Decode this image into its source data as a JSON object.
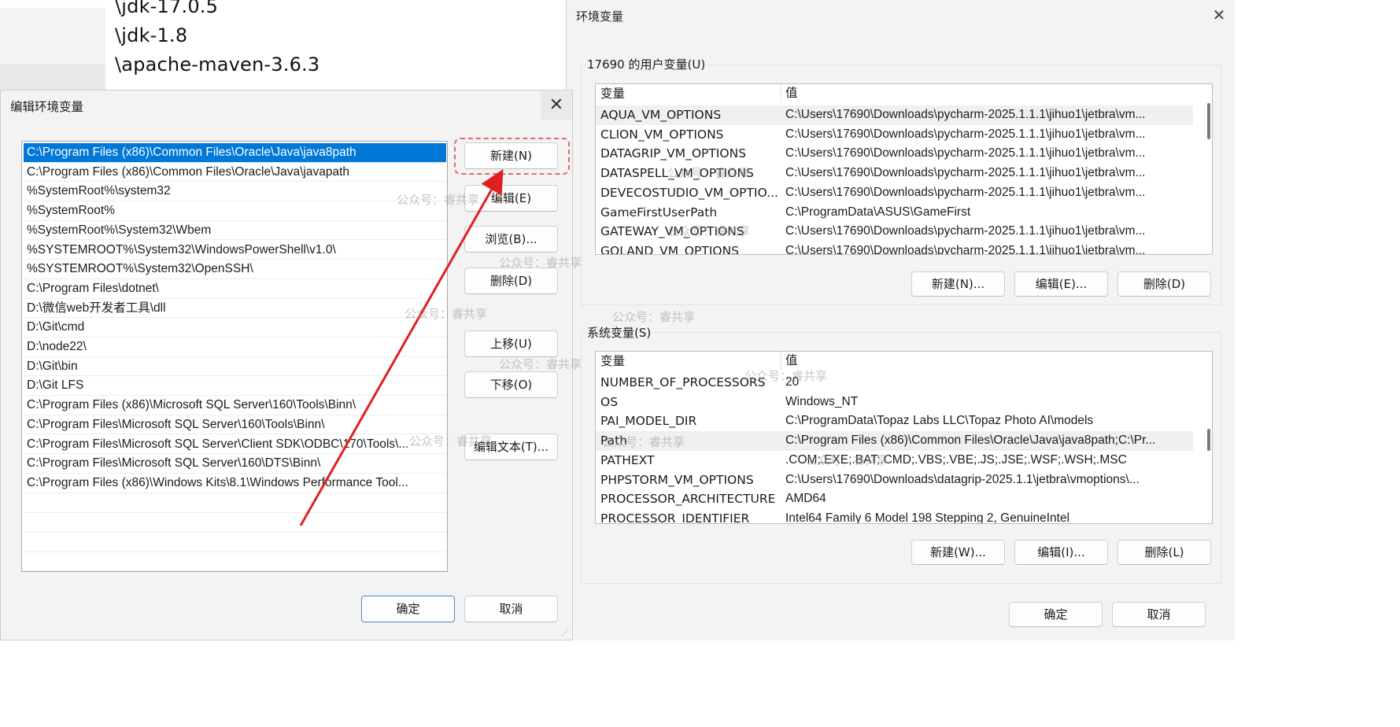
{
  "background_window": {
    "paths": [
      "\\jdk-17.0.5",
      "\\jdk-1.8",
      "\\apache-maven-3.6.3"
    ]
  },
  "env_dialog": {
    "title": "环境变量",
    "close_icon": "close-icon",
    "user_group_label": "17690 的用户变量(U)",
    "system_group_label": "系统变量(S)",
    "col_name": "变量",
    "col_value": "值",
    "user_vars": [
      {
        "name": "AQUA_VM_OPTIONS",
        "value": "C:\\Users\\17690\\Downloads\\pycharm-2025.1.1.1\\jihuo1\\jetbra\\vm..."
      },
      {
        "name": "CLION_VM_OPTIONS",
        "value": "C:\\Users\\17690\\Downloads\\pycharm-2025.1.1.1\\jihuo1\\jetbra\\vm..."
      },
      {
        "name": "DATAGRIP_VM_OPTIONS",
        "value": "C:\\Users\\17690\\Downloads\\pycharm-2025.1.1.1\\jihuo1\\jetbra\\vm..."
      },
      {
        "name": "DATASPELL_VM_OPTIONS",
        "value": "C:\\Users\\17690\\Downloads\\pycharm-2025.1.1.1\\jihuo1\\jetbra\\vm..."
      },
      {
        "name": "DEVECOSTUDIO_VM_OPTIO...",
        "value": "C:\\Users\\17690\\Downloads\\pycharm-2025.1.1.1\\jihuo1\\jetbra\\vm..."
      },
      {
        "name": "GameFirstUserPath",
        "value": "C:\\ProgramData\\ASUS\\GameFirst"
      },
      {
        "name": "GATEWAY_VM_OPTIONS",
        "value": "C:\\Users\\17690\\Downloads\\pycharm-2025.1.1.1\\jihuo1\\jetbra\\vm..."
      },
      {
        "name": "GOLAND_VM_OPTIONS",
        "value": "C:\\Users\\17690\\Downloads\\pycharm-2025.1.1.1\\jihuo1\\jetbra\\vm..."
      }
    ],
    "system_vars": [
      {
        "name": "NUMBER_OF_PROCESSORS",
        "value": "20"
      },
      {
        "name": "OS",
        "value": "Windows_NT"
      },
      {
        "name": "PAI_MODEL_DIR",
        "value": "C:\\ProgramData\\Topaz Labs LLC\\Topaz Photo AI\\models"
      },
      {
        "name": "Path",
        "value": "C:\\Program Files (x86)\\Common Files\\Oracle\\Java\\java8path;C:\\Pr..."
      },
      {
        "name": "PATHEXT",
        "value": ".COM;.EXE;.BAT;.CMD;.VBS;.VBE;.JS;.JSE;.WSF;.WSH;.MSC"
      },
      {
        "name": "PHPSTORM_VM_OPTIONS",
        "value": "C:\\Users\\17690\\Downloads\\datagrip-2025.1.1\\jetbra\\vmoptions\\..."
      },
      {
        "name": "PROCESSOR_ARCHITECTURE",
        "value": "AMD64"
      },
      {
        "name": "PROCESSOR_IDENTIFIER",
        "value": "Intel64 Family 6 Model 198 Stepping 2, GenuineIntel"
      }
    ],
    "user_buttons": {
      "new": "新建(N)...",
      "edit": "编辑(E)...",
      "delete": "删除(D)"
    },
    "system_buttons": {
      "new": "新建(W)...",
      "edit": "编辑(I)...",
      "delete": "删除(L)"
    },
    "ok": "确定",
    "cancel": "取消"
  },
  "edit_dialog": {
    "title": "编辑环境变量",
    "close_icon": "close-icon",
    "paths": [
      "C:\\Program Files (x86)\\Common Files\\Oracle\\Java\\java8path",
      "C:\\Program Files (x86)\\Common Files\\Oracle\\Java\\javapath",
      "%SystemRoot%\\system32",
      "%SystemRoot%",
      "%SystemRoot%\\System32\\Wbem",
      "%SYSTEMROOT%\\System32\\WindowsPowerShell\\v1.0\\",
      "%SYSTEMROOT%\\System32\\OpenSSH\\",
      "C:\\Program Files\\dotnet\\",
      "D:\\微信web开发者工具\\dll",
      "D:\\Git\\cmd",
      "D:\\node22\\",
      "D:\\Git\\bin",
      "D:\\Git LFS",
      "C:\\Program Files (x86)\\Microsoft SQL Server\\160\\Tools\\Binn\\",
      "C:\\Program Files\\Microsoft SQL Server\\160\\Tools\\Binn\\",
      "C:\\Program Files\\Microsoft SQL Server\\Client SDK\\ODBC\\170\\Tools\\...",
      "C:\\Program Files\\Microsoft SQL Server\\160\\DTS\\Binn\\",
      "C:\\Program Files (x86)\\Windows Kits\\8.1\\Windows Performance Tool..."
    ],
    "buttons": {
      "new": "新建(N)",
      "edit": "编辑(E)",
      "browse": "浏览(B)...",
      "delete": "删除(D)",
      "move_up": "上移(U)",
      "move_down": "下移(O)",
      "edit_text": "编辑文本(T)..."
    },
    "ok": "确定",
    "cancel": "取消"
  },
  "watermark_text": "公众号：睿共享",
  "colors": {
    "selection": "#0078d7",
    "annotation": "#e02020",
    "highlight_border": "#e36a6a"
  }
}
